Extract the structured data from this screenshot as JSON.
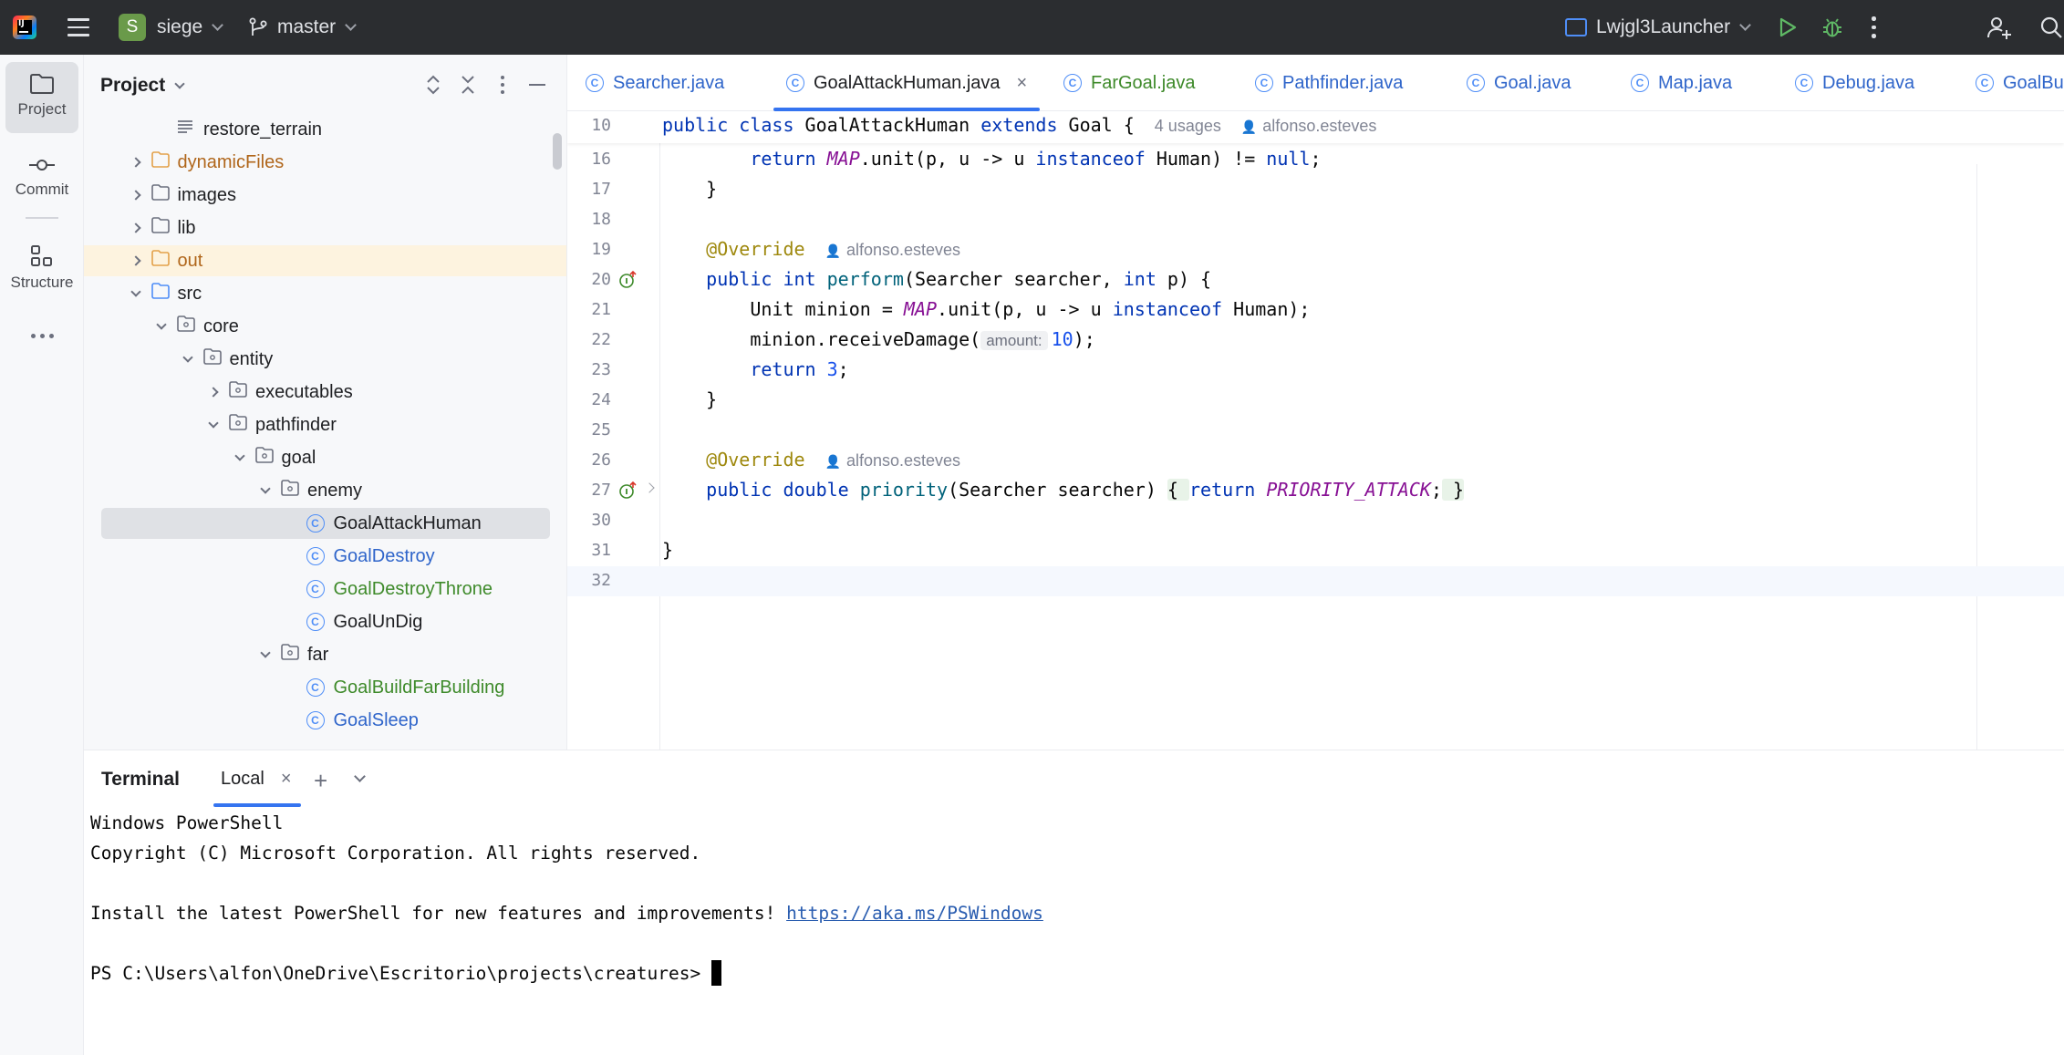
{
  "topbar": {
    "project_badge": "S",
    "project_name": "siege",
    "branch": "master",
    "run_config": "Lwjgl3Launcher"
  },
  "toolstrip": {
    "project": "Project",
    "commit": "Commit",
    "structure": "Structure"
  },
  "project_panel": {
    "title": "Project",
    "items": [
      {
        "label": "restore_terrain",
        "color": "#1e1f22"
      },
      {
        "label": "dynamicFiles",
        "color": "#b0661b"
      },
      {
        "label": "images",
        "color": "#1e1f22"
      },
      {
        "label": "lib",
        "color": "#1e1f22"
      },
      {
        "label": "out",
        "color": "#b0661b"
      },
      {
        "label": "src",
        "color": "#1e1f22"
      },
      {
        "label": "core",
        "color": "#1e1f22"
      },
      {
        "label": "entity",
        "color": "#1e1f22"
      },
      {
        "label": "executables",
        "color": "#1e1f22"
      },
      {
        "label": "pathfinder",
        "color": "#1e1f22"
      },
      {
        "label": "goal",
        "color": "#1e1f22"
      },
      {
        "label": "enemy",
        "color": "#1e1f22"
      },
      {
        "label": "GoalAttackHuman",
        "color": "#1e1f22"
      },
      {
        "label": "GoalDestroy",
        "color": "#2f65ca"
      },
      {
        "label": "GoalDestroyThrone",
        "color": "#3e8a2a"
      },
      {
        "label": "GoalUnDig",
        "color": "#1e1f22"
      },
      {
        "label": "far",
        "color": "#1e1f22"
      },
      {
        "label": "GoalBuildFarBuilding",
        "color": "#3e8a2a"
      },
      {
        "label": "GoalSleep",
        "color": "#2f65ca"
      }
    ]
  },
  "editor": {
    "tabs": [
      {
        "label": "Searcher.java",
        "color": "#2f65ca"
      },
      {
        "label": "GoalAttackHuman.java",
        "color": "#1e1f22"
      },
      {
        "label": "FarGoal.java",
        "color": "#3e8a2a"
      },
      {
        "label": "Pathfinder.java",
        "color": "#2f65ca"
      },
      {
        "label": "Goal.java",
        "color": "#2f65ca"
      },
      {
        "label": "Map.java",
        "color": "#2f65ca"
      },
      {
        "label": "Debug.java",
        "color": "#2f65ca"
      },
      {
        "label": "GoalBu",
        "color": "#2f65ca"
      }
    ],
    "lines": {
      "n10": "10",
      "n16": "16",
      "n17": "17",
      "n18": "18",
      "n19": "19",
      "n20": "20",
      "n21": "21",
      "n22": "22",
      "n23": "23",
      "n24": "24",
      "n25": "25",
      "n26": "26",
      "n27": "27",
      "n30": "30",
      "n31": "31",
      "n32": "32"
    },
    "usages": "4 usages",
    "author": "alfonso.esteves",
    "param_hint": "amount:"
  },
  "terminal": {
    "title": "Terminal",
    "tab": "Local",
    "line1": "Windows PowerShell",
    "line2": "Copyright (C) Microsoft Corporation. All rights reserved.",
    "line3_text": "Install the latest PowerShell for new features and improvements! ",
    "line3_link": "https://aka.ms/PSWindows",
    "prompt": "PS C:\\Users\\alfon\\OneDrive\\Escritorio\\projects\\creatures>"
  }
}
